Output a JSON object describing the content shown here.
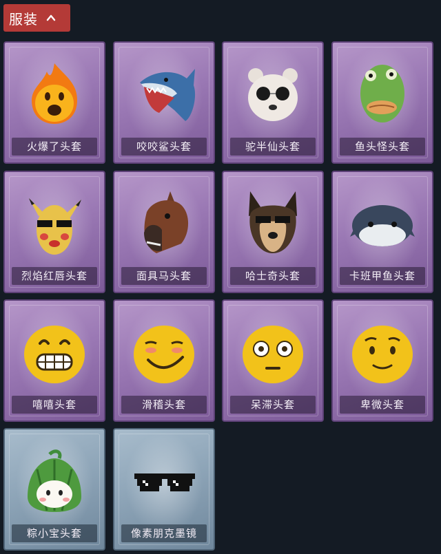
{
  "header": {
    "title": "服装",
    "icon": "chevron-up-icon"
  },
  "colors": {
    "background": "#141b24",
    "tab": "#b43a37",
    "epic": "#9a78b4",
    "rare": "#8ea5b8"
  },
  "items": [
    {
      "label": "火爆了头套",
      "rarity": "epic",
      "icon": "fire-mask-icon"
    },
    {
      "label": "咬咬鲨头套",
      "rarity": "epic",
      "icon": "shark-mask-icon"
    },
    {
      "label": "驼半仙头套",
      "rarity": "epic",
      "icon": "bear-sunglasses-mask-icon"
    },
    {
      "label": "鱼头怪头套",
      "rarity": "epic",
      "icon": "fish-head-mask-icon"
    },
    {
      "label": "烈焰红唇头套",
      "rarity": "epic",
      "icon": "pikachu-lips-mask-icon"
    },
    {
      "label": "面具马头套",
      "rarity": "epic",
      "icon": "horse-mask-icon"
    },
    {
      "label": "哈士奇头套",
      "rarity": "epic",
      "icon": "husky-mask-icon"
    },
    {
      "label": "卡班甲鱼头套",
      "rarity": "epic",
      "icon": "turtle-mask-icon"
    },
    {
      "label": "嘻嘻头套",
      "rarity": "epic",
      "icon": "grin-emoji-mask-icon"
    },
    {
      "label": "滑稽头套",
      "rarity": "epic",
      "icon": "smirk-emoji-mask-icon"
    },
    {
      "label": "呆滞头套",
      "rarity": "epic",
      "icon": "dazed-emoji-mask-icon"
    },
    {
      "label": "卑微头套",
      "rarity": "epic",
      "icon": "humble-emoji-mask-icon"
    },
    {
      "label": "粽小宝头套",
      "rarity": "rare",
      "icon": "zongzi-mask-icon"
    },
    {
      "label": "像素朋克墨镜",
      "rarity": "rare",
      "icon": "pixel-sunglasses-icon"
    }
  ]
}
